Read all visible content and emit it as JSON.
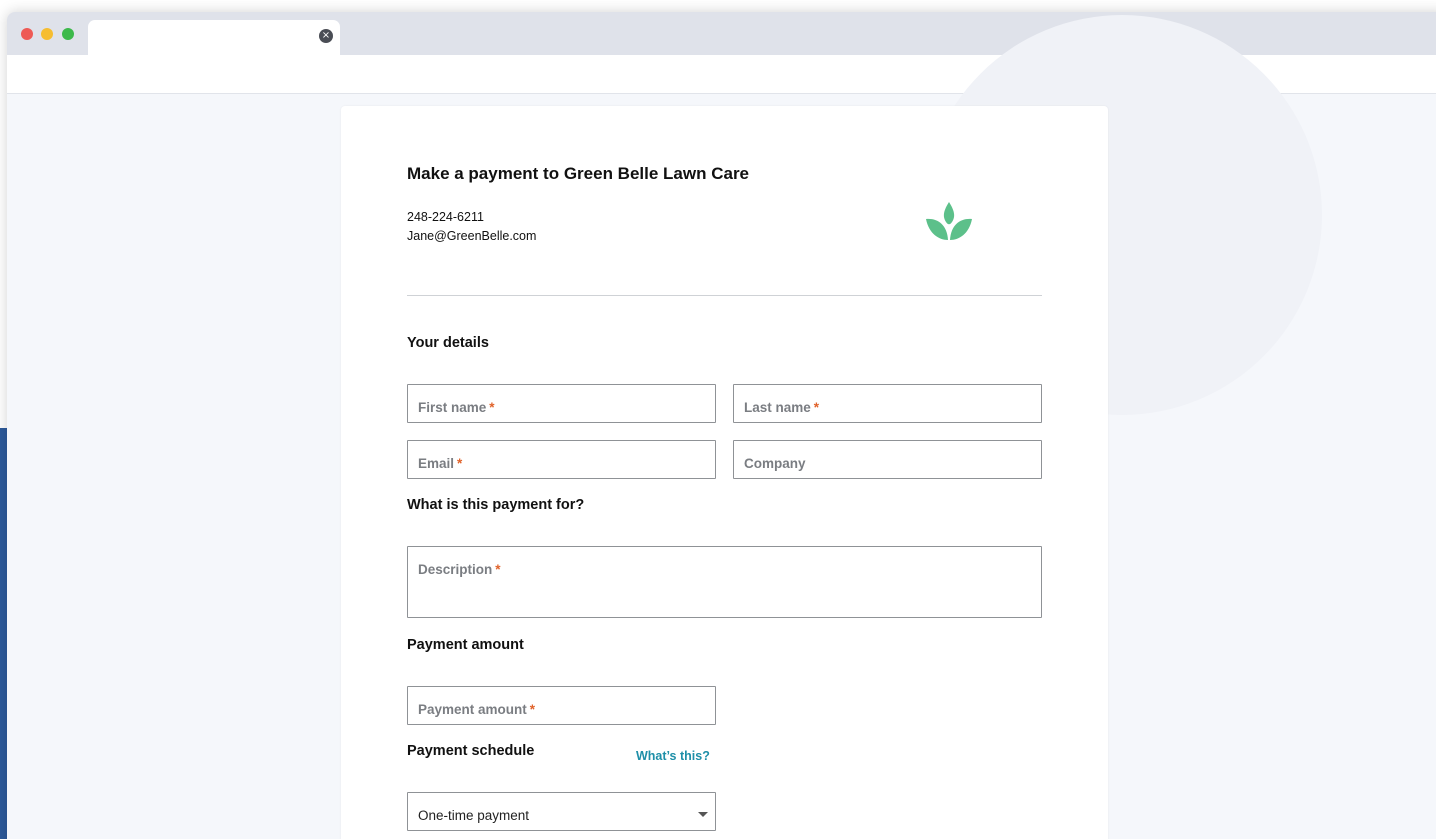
{
  "browser": {
    "tab_close_glyph": "×",
    "traffic_lights": [
      "close-dot",
      "minimize-dot",
      "maximize-dot"
    ]
  },
  "form": {
    "title": "Make a payment to Green Belle Lawn Care",
    "business_phone": "248-224-6211",
    "business_email": "Jane@GreenBelle.com",
    "logo_icon": "leaf-logo-icon",
    "logo_color": "#5cc08a",
    "required_marker": "*",
    "required_color": "#e0622a",
    "sections": {
      "your_details": "Your details",
      "payment_for": "What is this payment for?",
      "payment_amount": "Payment amount",
      "payment_schedule": "Payment schedule"
    },
    "fields": {
      "first_name": "First name",
      "last_name": "Last name",
      "email": "Email",
      "company": "Company",
      "description": "Description",
      "amount": "Payment amount"
    },
    "whats_this_link": "What’s this?",
    "schedule_selected": "One-time payment"
  }
}
